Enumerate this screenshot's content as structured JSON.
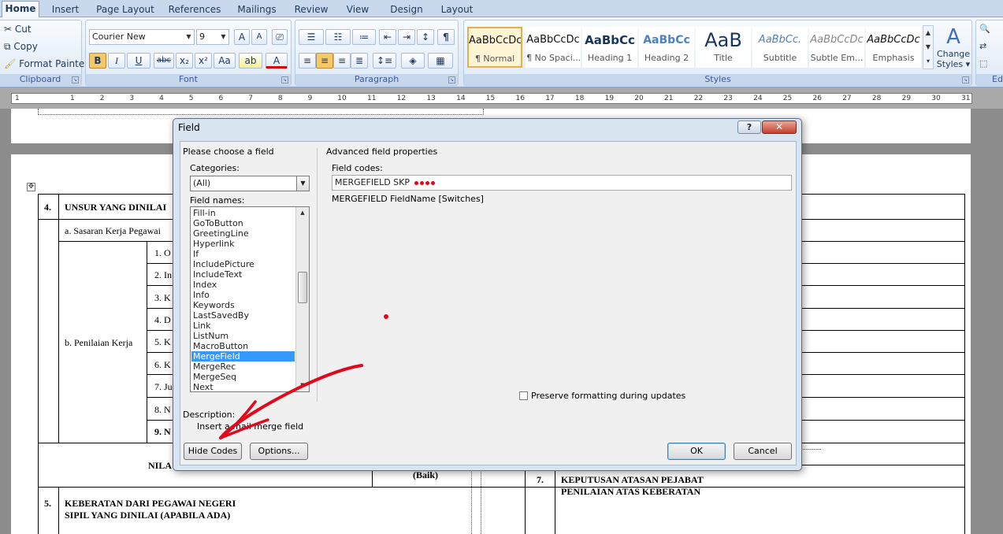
{
  "ribbon": {
    "tabs": [
      "Home",
      "Insert",
      "Page Layout",
      "References",
      "Mailings",
      "Review",
      "View",
      "Design",
      "Layout"
    ],
    "clipboard": {
      "cut": "Cut",
      "copy": "Copy",
      "format_painter": "Format Painter",
      "label": "Clipboard"
    },
    "font": {
      "name": "Courier New",
      "size": "9",
      "label": "Font",
      "grow": "A",
      "shrink": "A",
      "change_case": "Aa",
      "bold": "B",
      "italic": "I",
      "underline": "U",
      "strike": "abc",
      "subscript": "x₂",
      "superscript": "x²"
    },
    "paragraph": {
      "label": "Paragraph",
      "show_marks": "¶"
    },
    "styles": {
      "label": "Styles",
      "items": [
        {
          "preview": "AaBbCcDc",
          "name": "¶ Normal"
        },
        {
          "preview": "AaBbCcDc",
          "name": "¶ No Spaci..."
        },
        {
          "preview": "AaBbCc",
          "name": "Heading 1"
        },
        {
          "preview": "AaBbCc",
          "name": "Heading 2"
        },
        {
          "preview": "AaB",
          "name": "Title"
        },
        {
          "preview": "AaBbCc.",
          "name": "Subtitle"
        },
        {
          "preview": "AaBbCcDc",
          "name": "Subtle Em..."
        },
        {
          "preview": "AaBbCcDc",
          "name": "Emphasis"
        }
      ],
      "change_styles_line1": "Change",
      "change_styles_line2": "Styles ▾"
    },
    "editing": {
      "label": "Edi"
    },
    "colors": {
      "accent": "#3b5998",
      "selected_style": "#e5b04b"
    }
  },
  "ruler": {
    "numbers": [
      "1",
      "1",
      "2",
      "3",
      "4",
      "5",
      "6",
      "7",
      "8",
      "9",
      "10",
      "11",
      "12",
      "13",
      "14",
      "15",
      "16",
      "17",
      "18",
      "19",
      "20",
      "21",
      "22",
      "23",
      "24",
      "25",
      "26",
      "27",
      "28",
      "29",
      "30",
      "31"
    ]
  },
  "document": {
    "row4_num": "4.",
    "row4_title": "UNSUR YANG DINILAI",
    "sasaran": "a.  Sasaran Kerja Pegawai",
    "penilaian": "b. Penilaian Kerja",
    "items": [
      "1. O",
      "2. In",
      "3. K",
      "4. D",
      "5. K",
      "6. K",
      "7. Ju",
      "8. N",
      "9. N"
    ],
    "nila": "NILA",
    "baik": "(Baik)",
    "row5_num": "5.",
    "row5_line1": "KEBERATAN DARI PEGAWAI NEGERI",
    "row5_line2": "SIPIL YANG DINILAI (APABILA ADA)",
    "row7_num": "7.",
    "row7_line1": "KEPUTUSAN ATASAN PEJABAT",
    "row7_line2": "PENILAIAN ATAS KEBERATAN"
  },
  "dialog": {
    "title": "Field",
    "help": "?",
    "close": "✕",
    "choose_label": "Please choose a field",
    "categories_label": "Categories:",
    "category_value": "(All)",
    "field_names_label": "Field names:",
    "field_names": [
      "Fill-in",
      "GoToButton",
      "GreetingLine",
      "Hyperlink",
      "If",
      "IncludePicture",
      "IncludeText",
      "Index",
      "Info",
      "Keywords",
      "LastSavedBy",
      "Link",
      "ListNum",
      "MacroButton",
      "MergeField",
      "MergeRec",
      "MergeSeq",
      "Next"
    ],
    "selected_field": "MergeField",
    "advanced_label": "Advanced field properties",
    "field_codes_label": "Field codes:",
    "field_codes_value": "MERGEFIELD  SKP",
    "syntax_hint": "MERGEFIELD FieldName [Switches]",
    "preserve_label": "Preserve formatting during updates",
    "description_label": "Description:",
    "description_text": "Insert a mail merge field",
    "hide_codes": "Hide Codes",
    "options": "Options...",
    "ok": "OK",
    "cancel": "Cancel"
  },
  "annotation": {
    "arrow_color": "#e0081a"
  }
}
